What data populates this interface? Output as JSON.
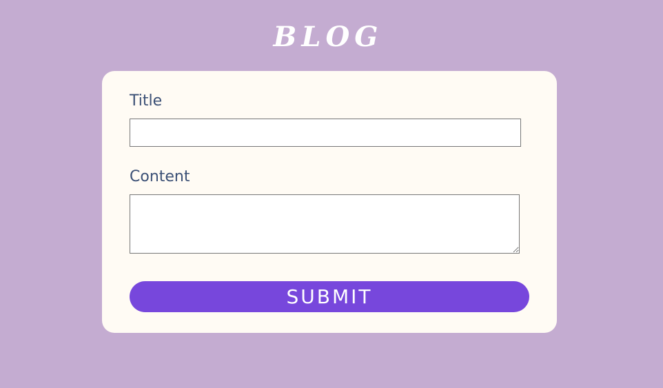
{
  "header": {
    "title": "BLOG"
  },
  "form": {
    "title_label": "Title",
    "title_value": "",
    "title_placeholder": "",
    "content_label": "Content",
    "content_value": "",
    "content_placeholder": "",
    "submit_label": "SUBMIT"
  },
  "colors": {
    "background": "#c4acd1",
    "card": "#fffbf4",
    "label_text": "#3a4f75",
    "submit_button": "#7747dc",
    "title_text": "#ffffff"
  }
}
